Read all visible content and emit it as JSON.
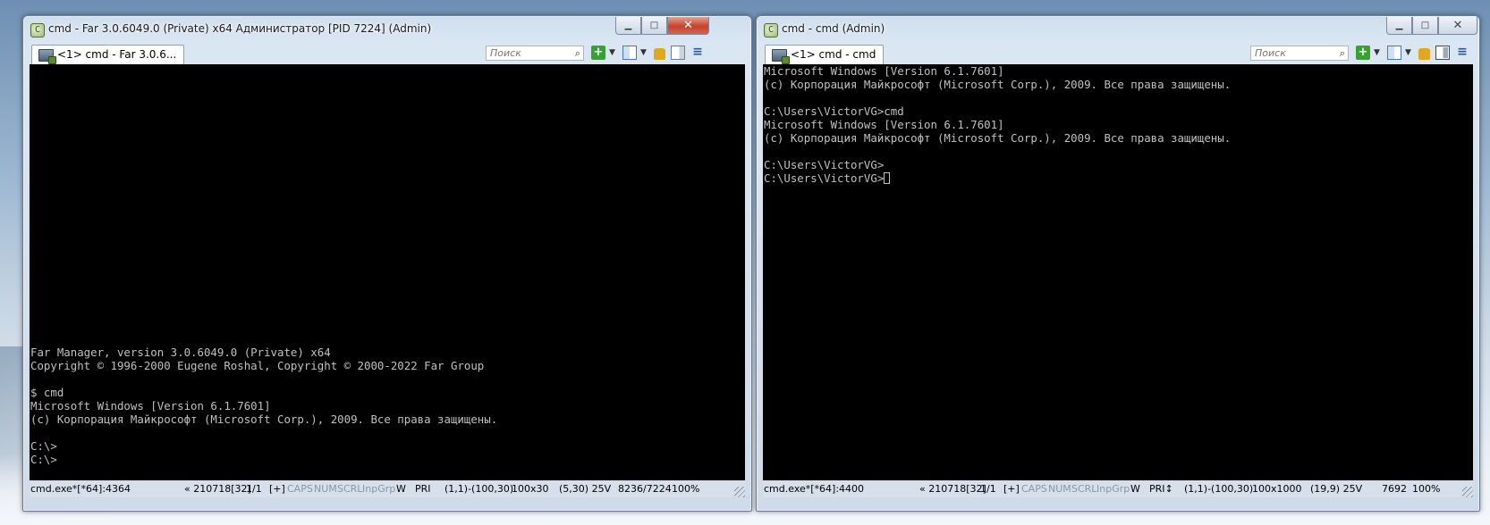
{
  "left_window": {
    "title": "cmd - Far 3.0.6049.0 (Private) x64 Администратор [PID 7224] (Admin)",
    "tab_label": "<1> cmd - Far 3.0.6...",
    "search_placeholder": "Поиск",
    "console_lines": [
      "Far Manager, version 3.0.6049.0 (Private) x64",
      "Copyright © 1996-2000 Eugene Roshal, Copyright © 2000-2022 Far Group",
      "",
      "$ cmd",
      "Microsoft Windows [Version 6.1.7601]",
      "(c) Корпорация Майкрософт (Microsoft Corp.), 2009. Все права защищены.",
      "",
      "C:\\>",
      "C:\\>"
    ],
    "status": {
      "process": "cmd.exe*[*64]:4364",
      "build": "« 210718[32]",
      "pages": "1/1",
      "plus": "[+]",
      "caps": "CAPS",
      "num": "NUM",
      "scrl": "SCRL",
      "inpgrp": "InpGrp",
      "w": "W",
      "pri": "PRI",
      "region": "(1,1)-(100,30)",
      "size": "100x30",
      "cursor": "(5,30) 25V",
      "mem": "8236/7224",
      "zoom": "100%"
    }
  },
  "right_window": {
    "title": "cmd - cmd (Admin)",
    "tab_label": "<1> cmd - cmd",
    "search_placeholder": "Поиск",
    "console_lines": [
      "Microsoft Windows [Version 6.1.7601]",
      "(c) Корпорация Майкрософт (Microsoft Corp.), 2009. Все права защищены.",
      "",
      "C:\\Users\\VictorVG>cmd",
      "Microsoft Windows [Version 6.1.7601]",
      "(c) Корпорация Майкрософт (Microsoft Corp.), 2009. Все права защищены.",
      "",
      "C:\\Users\\VictorVG>"
    ],
    "prompt_line": "C:\\Users\\VictorVG>",
    "status": {
      "process": "cmd.exe*[*64]:4400",
      "build": "« 210718[32]",
      "pages": "1/1",
      "plus": "[+]",
      "caps": "CAPS",
      "num": "NUM",
      "scrl": "SCRL",
      "inpgrp": "InpGrp",
      "w": "W",
      "pri": "PRI↕",
      "region": "(1,1)-(100,30)",
      "size": "100x1000",
      "cursor": "(19,9) 25V",
      "mem": "7692",
      "zoom": "100%"
    }
  },
  "icons": [
    "conemu-app-icon",
    "minimize-icon",
    "maximize-icon",
    "close-icon",
    "console-tab-icon",
    "search-icon",
    "new-console-icon",
    "chevron-down-icon",
    "panel-view-icon",
    "lock-icon",
    "split-icon",
    "menu-icon",
    "resize-grip-icon"
  ],
  "colors": {
    "console_bg": "#000000",
    "console_fg": "#c0c0c0",
    "status_bg": "#d7e0ea",
    "close_red": "#c6422a",
    "new_green": "#39a035"
  }
}
